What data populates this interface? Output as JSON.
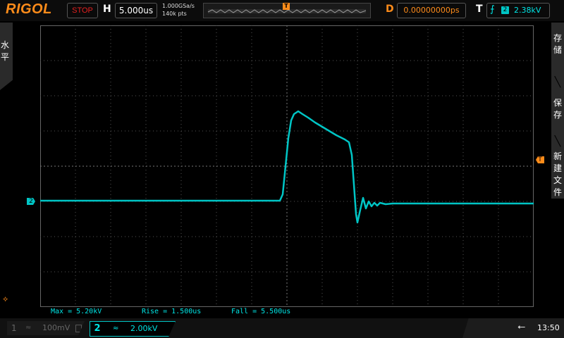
{
  "topbar": {
    "brand": "RIGOL",
    "run_status": "STOP",
    "horizontal_label": "H",
    "timebase": "5.000us",
    "sample_rate": "1.000GSa/s",
    "memory_depth": "140k pts",
    "trigger_position_label": "T",
    "delay_label": "D",
    "delay_value": "0.00000000ps",
    "trigger_label": "T",
    "trigger_edge_icon": "rising-edge-icon",
    "trigger_source": "2",
    "trigger_level": "2.38kV"
  },
  "side_tabs": {
    "left": "水平",
    "right": [
      "存储",
      "保存",
      "新建文件"
    ]
  },
  "markers": {
    "channel2": "2",
    "trigger_level": "T"
  },
  "measurements": [
    {
      "label": "Max = 5.20kV"
    },
    {
      "label": "Rise = 1.500us"
    },
    {
      "label": "Fall = 5.500us"
    }
  ],
  "channels": [
    {
      "number": "1",
      "coupling": "≈",
      "scale": "100mV",
      "bw_icon": "bandwidth-limit-icon"
    },
    {
      "number": "2",
      "coupling": "≈",
      "scale": "2.00kV"
    }
  ],
  "status": {
    "usb_icon": "usb-icon",
    "time": "13:50"
  },
  "colors": {
    "channel2": "#00c5c5",
    "accent": "#ff8c1a",
    "stop": "#e52020"
  }
}
